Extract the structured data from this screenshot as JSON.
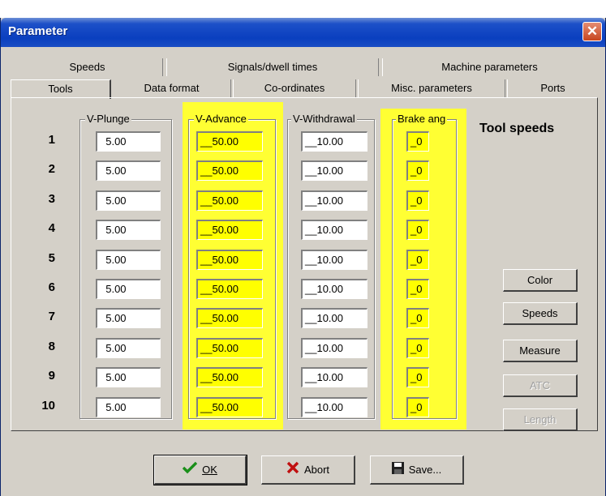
{
  "window": {
    "title": "Parameter",
    "close_glyph": "✕"
  },
  "tabs_back": [
    "Speeds",
    "Signals/dwell times",
    "Machine parameters"
  ],
  "tabs_front": [
    "Tools",
    "Data format",
    "Co-ordinates",
    "Misc. parameters",
    "Ports"
  ],
  "groups": {
    "v_plunge": "V-Plunge",
    "v_advance": "V-Advance",
    "v_withdrawal": "V-Withdrawal",
    "brake_ang": "Brake ang"
  },
  "rows": [
    {
      "num": "1",
      "plunge": "  5.00",
      "advance": "__50.00",
      "withdrawal": "__10.00",
      "brake": "_0"
    },
    {
      "num": "2",
      "plunge": "  5.00",
      "advance": "__50.00",
      "withdrawal": "__10.00",
      "brake": "_0"
    },
    {
      "num": "3",
      "plunge": "  5.00",
      "advance": "__50.00",
      "withdrawal": "__10.00",
      "brake": "_0"
    },
    {
      "num": "4",
      "plunge": "  5.00",
      "advance": "__50.00",
      "withdrawal": "__10.00",
      "brake": "_0"
    },
    {
      "num": "5",
      "plunge": "  5.00",
      "advance": "__50.00",
      "withdrawal": "__10.00",
      "brake": "_0"
    },
    {
      "num": "6",
      "plunge": "  5.00",
      "advance": "__50.00",
      "withdrawal": "__10.00",
      "brake": "_0"
    },
    {
      "num": "7",
      "plunge": "  5.00",
      "advance": "__50.00",
      "withdrawal": "__10.00",
      "brake": "_0"
    },
    {
      "num": "8",
      "plunge": "  5.00",
      "advance": "__50.00",
      "withdrawal": "__10.00",
      "brake": "_0"
    },
    {
      "num": "9",
      "plunge": "  5.00",
      "advance": "__50.00",
      "withdrawal": "__10.00",
      "brake": "_0"
    },
    {
      "num": "10",
      "plunge": "  5.00",
      "advance": "__50.00",
      "withdrawal": "__10.00",
      "brake": "_0"
    }
  ],
  "side": {
    "title": "Tool speeds",
    "color": "Color",
    "speeds": "Speeds",
    "measure": "Measure",
    "atc": "ATC",
    "length": "Length"
  },
  "buttons": {
    "ok": "OK",
    "abort": "Abort",
    "save": "Save..."
  },
  "colors": {
    "highlight": "#ffff33",
    "field_highlight": "#ffff00",
    "dialog": "#d4d0c8",
    "titlebar": "#0a3fbf"
  }
}
